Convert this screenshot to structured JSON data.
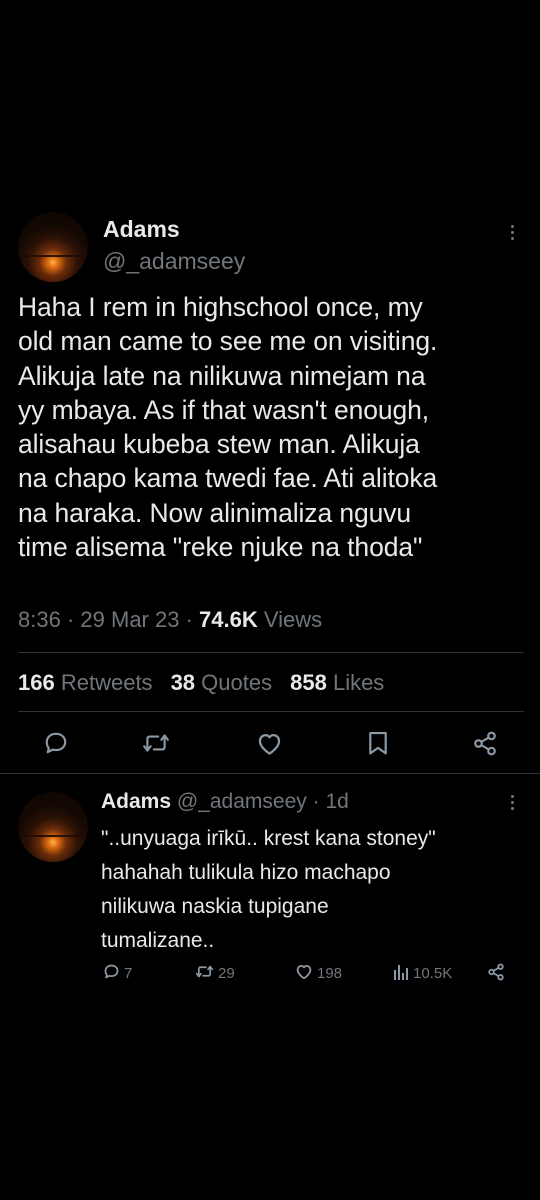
{
  "tweet": {
    "author_name": "Adams",
    "author_handle": "@_adamseey",
    "text": "Haha I rem in highschool once, my\nold man came to see me on visiting.\nAlikuja late na nilikuwa nimejam na\nyy mbaya. As if that wasn't enough,\nalisahau kubeba stew man. Alikuja\nna chapo kama twedi fae. Ati alitoka\nna haraka. Now alinimaliza nguvu\ntime alisema \"reke njuke na thoda\"",
    "time": "8:36",
    "date": "29 Mar 23",
    "views_count": "74.6K",
    "views_label": "Views",
    "retweets_count": "166",
    "retweets_label": "Retweets",
    "quotes_count": "38",
    "quotes_label": "Quotes",
    "likes_count": "858",
    "likes_label": "Likes"
  },
  "reply": {
    "author_name": "Adams",
    "author_handle": "@_adamseey",
    "age": "1d",
    "text": "\"..unyuaga irīkū.. krest kana stoney\"\nhahahah tulikula hizo machapo\nnilikuwa naskia tupigane\ntumalizane..",
    "replies_count": "7",
    "retweets_count": "29",
    "likes_count": "198",
    "views_count": "10.5K"
  },
  "icons": {
    "more": "more-vertical-icon",
    "reply": "reply-icon",
    "retweet": "retweet-icon",
    "like": "heart-icon",
    "bookmark": "bookmark-icon",
    "share": "share-icon",
    "views": "views-bar-icon"
  },
  "colors": {
    "background": "#000000",
    "text_primary": "#e7e9ea",
    "text_secondary": "#71767b",
    "divider": "#2f3336"
  }
}
